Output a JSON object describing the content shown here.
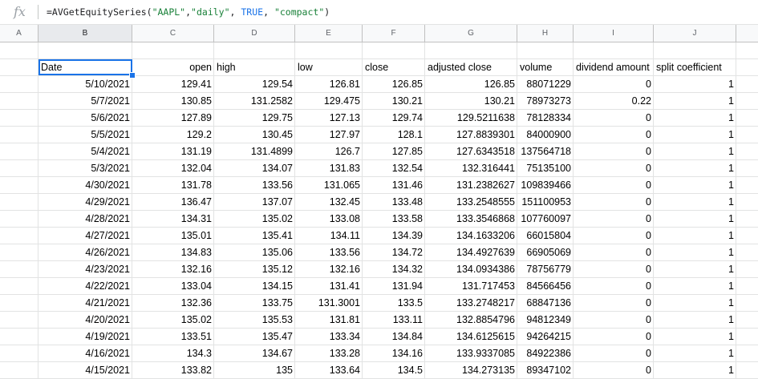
{
  "formula_bar": {
    "fx_label": "fx",
    "func": "=AVGetEquitySeries(",
    "arg1": "\"AAPL\"",
    "sep1": ",",
    "arg2": "\"daily\"",
    "sep2": ", ",
    "arg3": "TRUE",
    "sep3": ", ",
    "arg4": "\"compact\"",
    "close": ")"
  },
  "columns": [
    "A",
    "B",
    "C",
    "D",
    "E",
    "F",
    "G",
    "H",
    "I",
    "J"
  ],
  "selected_column": "B",
  "headers": [
    "Date",
    "open",
    "high",
    "low",
    "close",
    "adjusted close",
    "volume",
    "dividend amount",
    "split coefficient"
  ],
  "rows": [
    [
      "5/10/2021",
      "129.41",
      "129.54",
      "126.81",
      "126.85",
      "126.85",
      "88071229",
      "0",
      "1"
    ],
    [
      "5/7/2021",
      "130.85",
      "131.2582",
      "129.475",
      "130.21",
      "130.21",
      "78973273",
      "0.22",
      "1"
    ],
    [
      "5/6/2021",
      "127.89",
      "129.75",
      "127.13",
      "129.74",
      "129.5211638",
      "78128334",
      "0",
      "1"
    ],
    [
      "5/5/2021",
      "129.2",
      "130.45",
      "127.97",
      "128.1",
      "127.8839301",
      "84000900",
      "0",
      "1"
    ],
    [
      "5/4/2021",
      "131.19",
      "131.4899",
      "126.7",
      "127.85",
      "127.6343518",
      "137564718",
      "0",
      "1"
    ],
    [
      "5/3/2021",
      "132.04",
      "134.07",
      "131.83",
      "132.54",
      "132.316441",
      "75135100",
      "0",
      "1"
    ],
    [
      "4/30/2021",
      "131.78",
      "133.56",
      "131.065",
      "131.46",
      "131.2382627",
      "109839466",
      "0",
      "1"
    ],
    [
      "4/29/2021",
      "136.47",
      "137.07",
      "132.45",
      "133.48",
      "133.2548555",
      "151100953",
      "0",
      "1"
    ],
    [
      "4/28/2021",
      "134.31",
      "135.02",
      "133.08",
      "133.58",
      "133.3546868",
      "107760097",
      "0",
      "1"
    ],
    [
      "4/27/2021",
      "135.01",
      "135.41",
      "134.11",
      "134.39",
      "134.1633206",
      "66015804",
      "0",
      "1"
    ],
    [
      "4/26/2021",
      "134.83",
      "135.06",
      "133.56",
      "134.72",
      "134.4927639",
      "66905069",
      "0",
      "1"
    ],
    [
      "4/23/2021",
      "132.16",
      "135.12",
      "132.16",
      "134.32",
      "134.0934386",
      "78756779",
      "0",
      "1"
    ],
    [
      "4/22/2021",
      "133.04",
      "134.15",
      "131.41",
      "131.94",
      "131.717453",
      "84566456",
      "0",
      "1"
    ],
    [
      "4/21/2021",
      "132.36",
      "133.75",
      "131.3001",
      "133.5",
      "133.2748217",
      "68847136",
      "0",
      "1"
    ],
    [
      "4/20/2021",
      "135.02",
      "135.53",
      "131.81",
      "133.11",
      "132.8854796",
      "94812349",
      "0",
      "1"
    ],
    [
      "4/19/2021",
      "133.51",
      "135.47",
      "133.34",
      "134.84",
      "134.6125615",
      "94264215",
      "0",
      "1"
    ],
    [
      "4/16/2021",
      "134.3",
      "134.67",
      "133.28",
      "134.16",
      "133.9337085",
      "84922386",
      "0",
      "1"
    ],
    [
      "4/15/2021",
      "133.82",
      "135",
      "133.64",
      "134.5",
      "134.273135",
      "89347102",
      "0",
      "1"
    ]
  ]
}
